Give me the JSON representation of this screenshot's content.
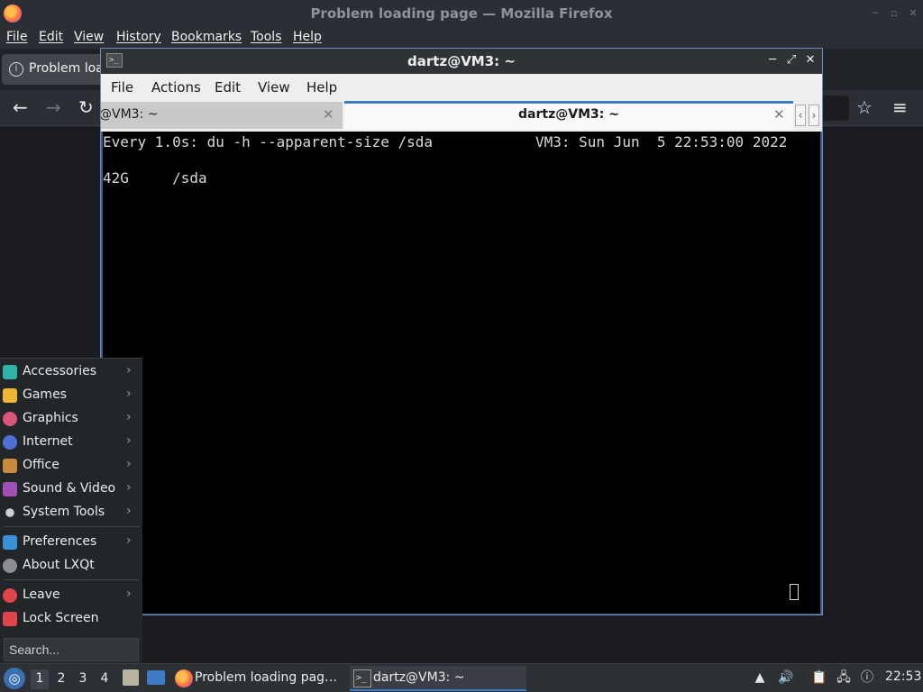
{
  "firefox": {
    "title": "Problem loading page — Mozilla Firefox",
    "menus": [
      "File",
      "Edit",
      "View",
      "History",
      "Bookmarks",
      "Tools",
      "Help"
    ],
    "tab_label": "Problem loa",
    "icons": {
      "back": "back-arrow-icon",
      "forward": "forward-arrow-icon",
      "reload": "reload-icon",
      "bookmark": "star-icon",
      "menu": "hamburger-icon"
    }
  },
  "terminal": {
    "title": "dartz@VM3: ~",
    "menus": [
      "File",
      "Actions",
      "Edit",
      "View",
      "Help"
    ],
    "tabs": [
      {
        "label": "@VM3: ~",
        "active": false
      },
      {
        "label": "dartz@VM3: ~",
        "active": true
      }
    ],
    "screen": {
      "line1_left": "Every 1.0s: du -h --apparent-size /sda",
      "line1_right": "VM3: Sun Jun  5 22:53:00 2022",
      "line2": "42G     /sda"
    }
  },
  "app_menu": {
    "items": [
      {
        "label": "Accessories",
        "icon": "accessories-icon",
        "color": "#2fb3a5",
        "submenu": true
      },
      {
        "label": "Games",
        "icon": "games-icon",
        "color": "#f0b632",
        "submenu": true
      },
      {
        "label": "Graphics",
        "icon": "graphics-icon",
        "color": "#d9567a",
        "submenu": true
      },
      {
        "label": "Internet",
        "icon": "internet-icon",
        "color": "#4f6fd8",
        "submenu": true
      },
      {
        "label": "Office",
        "icon": "office-icon",
        "color": "#c98a3c",
        "submenu": true
      },
      {
        "label": "Sound & Video",
        "icon": "sound-video-icon",
        "color": "#a04fb5",
        "submenu": true
      },
      {
        "label": "System Tools",
        "icon": "system-tools-icon",
        "color": "#d0d0d0",
        "submenu": true
      },
      {
        "label": "Preferences",
        "icon": "preferences-icon",
        "color": "#3a8fd6",
        "submenu": true
      },
      {
        "label": "About LXQt",
        "icon": "info-icon",
        "color": "#8a8d92",
        "submenu": false
      },
      {
        "label": "Leave",
        "icon": "power-icon",
        "color": "#e0454a",
        "submenu": true
      },
      {
        "label": "Lock Screen",
        "icon": "lock-icon",
        "color": "#e0454a",
        "submenu": false
      }
    ],
    "search_placeholder": "Search..."
  },
  "taskbar": {
    "desktops": [
      "1",
      "2",
      "3",
      "4"
    ],
    "active_desktop": "1",
    "tasks": [
      {
        "label": "Problem loading pag…",
        "icon": "firefox-icon"
      },
      {
        "label": "dartz@VM3: ~",
        "icon": "terminal-icon"
      }
    ],
    "clock": "22:53"
  },
  "colors": {
    "accent": "#3d7bc4",
    "terminal_bg": "#000000"
  }
}
